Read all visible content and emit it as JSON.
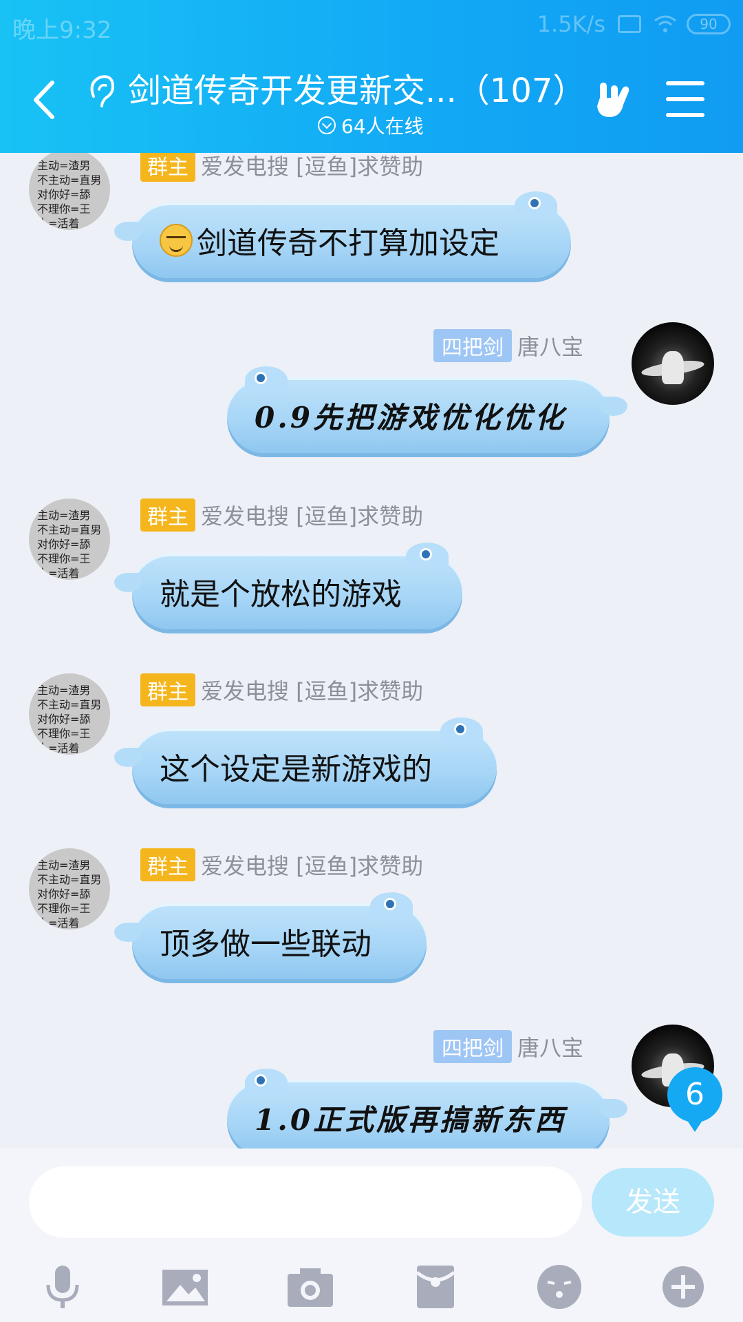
{
  "status_bar": {
    "time": "晚上9:32",
    "speed": "1.5K/s",
    "battery": "90"
  },
  "header": {
    "title": "剑道传奇开发更新交...（107）",
    "online": "64人在线"
  },
  "messages": [
    {
      "side": "left",
      "badge": "群主",
      "name": "爱发电搜 [逗鱼]求赞助",
      "text": "剑道传奇不打算加设定",
      "avatar_text": [
        "主动=渣男",
        "不主动=直男",
        "对你好=舔",
        "不理你=王",
        "人=活着"
      ]
    },
    {
      "side": "right",
      "badge": "四把剑",
      "name": "唐八宝",
      "text": "0.9先把游戏优化优化"
    },
    {
      "side": "left",
      "badge": "群主",
      "name": "爱发电搜 [逗鱼]求赞助",
      "text": "就是个放松的游戏",
      "avatar_text": [
        "主动=渣男",
        "不主动=直男",
        "对你好=舔",
        "不理你=王",
        "人=活着"
      ]
    },
    {
      "side": "left",
      "badge": "群主",
      "name": "爱发电搜 [逗鱼]求赞助",
      "text": "这个设定是新游戏的",
      "avatar_text": [
        "主动=渣男",
        "不主动=直男",
        "对你好=舔",
        "不理你=王",
        "人=活着"
      ]
    },
    {
      "side": "left",
      "badge": "群主",
      "name": "爱发电搜 [逗鱼]求赞助",
      "text": "顶多做一些联动",
      "avatar_text": [
        "主动=渣男",
        "不主动=直男",
        "对你好=舔",
        "不理你=王",
        "人=活着"
      ]
    },
    {
      "side": "right",
      "badge": "四把剑",
      "name": "唐八宝",
      "text": "1.0正式版再搞新东西"
    }
  ],
  "unread_count": "6",
  "input": {
    "value": "",
    "placeholder": "",
    "send_label": "发送"
  },
  "toolbar": [
    "microphone-icon",
    "image-icon",
    "camera-icon",
    "red-packet-icon",
    "emoji-icon",
    "plus-icon"
  ],
  "colors": {
    "header": "#12a8f5",
    "owner_badge": "#f5b51c",
    "title_badge": "#9ec6f5",
    "bubble": "#a6d5f6"
  }
}
